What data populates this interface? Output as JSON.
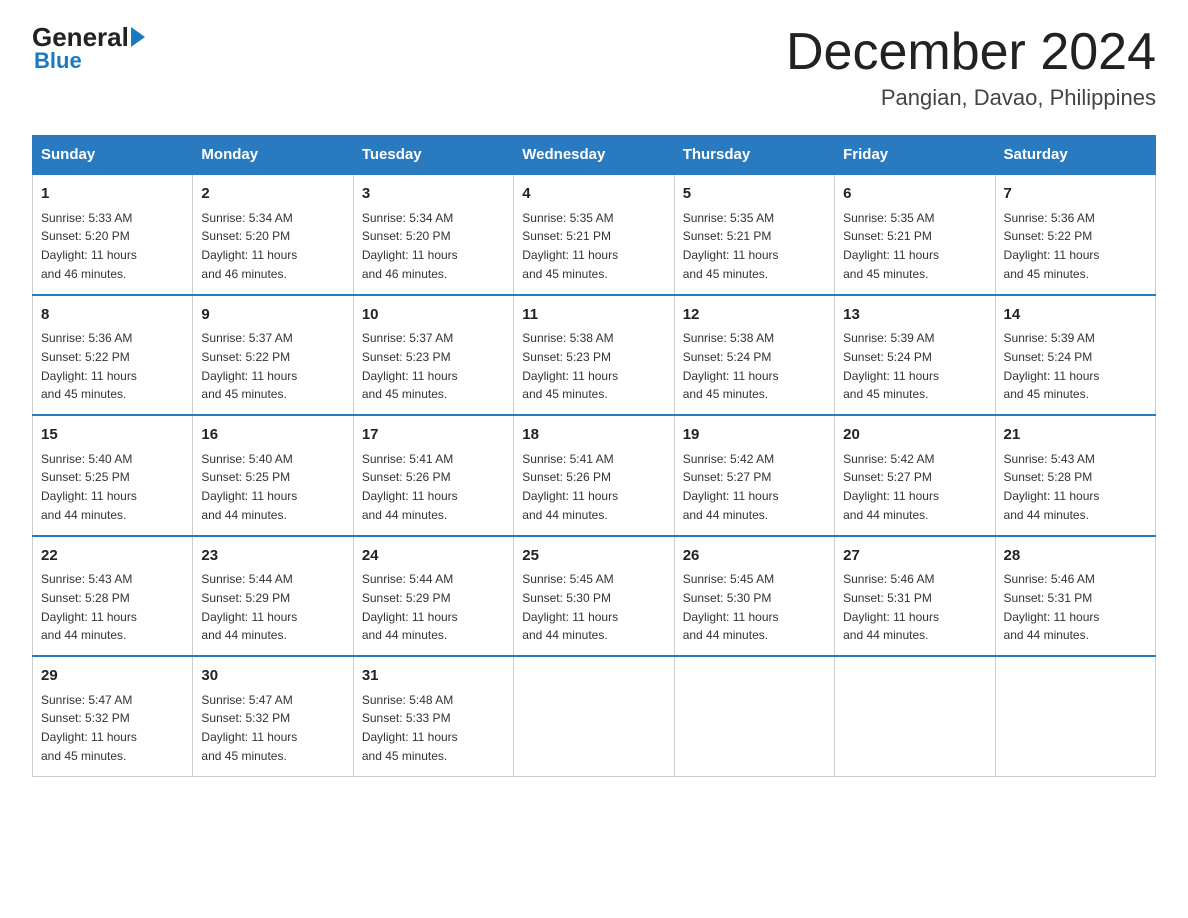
{
  "header": {
    "logo_general": "General",
    "logo_blue": "Blue",
    "month_title": "December 2024",
    "subtitle": "Pangian, Davao, Philippines"
  },
  "days_of_week": [
    "Sunday",
    "Monday",
    "Tuesday",
    "Wednesday",
    "Thursday",
    "Friday",
    "Saturday"
  ],
  "weeks": [
    [
      {
        "day": "1",
        "sunrise": "5:33 AM",
        "sunset": "5:20 PM",
        "daylight": "11 hours and 46 minutes."
      },
      {
        "day": "2",
        "sunrise": "5:34 AM",
        "sunset": "5:20 PM",
        "daylight": "11 hours and 46 minutes."
      },
      {
        "day": "3",
        "sunrise": "5:34 AM",
        "sunset": "5:20 PM",
        "daylight": "11 hours and 46 minutes."
      },
      {
        "day": "4",
        "sunrise": "5:35 AM",
        "sunset": "5:21 PM",
        "daylight": "11 hours and 45 minutes."
      },
      {
        "day": "5",
        "sunrise": "5:35 AM",
        "sunset": "5:21 PM",
        "daylight": "11 hours and 45 minutes."
      },
      {
        "day": "6",
        "sunrise": "5:35 AM",
        "sunset": "5:21 PM",
        "daylight": "11 hours and 45 minutes."
      },
      {
        "day": "7",
        "sunrise": "5:36 AM",
        "sunset": "5:22 PM",
        "daylight": "11 hours and 45 minutes."
      }
    ],
    [
      {
        "day": "8",
        "sunrise": "5:36 AM",
        "sunset": "5:22 PM",
        "daylight": "11 hours and 45 minutes."
      },
      {
        "day": "9",
        "sunrise": "5:37 AM",
        "sunset": "5:22 PM",
        "daylight": "11 hours and 45 minutes."
      },
      {
        "day": "10",
        "sunrise": "5:37 AM",
        "sunset": "5:23 PM",
        "daylight": "11 hours and 45 minutes."
      },
      {
        "day": "11",
        "sunrise": "5:38 AM",
        "sunset": "5:23 PM",
        "daylight": "11 hours and 45 minutes."
      },
      {
        "day": "12",
        "sunrise": "5:38 AM",
        "sunset": "5:24 PM",
        "daylight": "11 hours and 45 minutes."
      },
      {
        "day": "13",
        "sunrise": "5:39 AM",
        "sunset": "5:24 PM",
        "daylight": "11 hours and 45 minutes."
      },
      {
        "day": "14",
        "sunrise": "5:39 AM",
        "sunset": "5:24 PM",
        "daylight": "11 hours and 45 minutes."
      }
    ],
    [
      {
        "day": "15",
        "sunrise": "5:40 AM",
        "sunset": "5:25 PM",
        "daylight": "11 hours and 44 minutes."
      },
      {
        "day": "16",
        "sunrise": "5:40 AM",
        "sunset": "5:25 PM",
        "daylight": "11 hours and 44 minutes."
      },
      {
        "day": "17",
        "sunrise": "5:41 AM",
        "sunset": "5:26 PM",
        "daylight": "11 hours and 44 minutes."
      },
      {
        "day": "18",
        "sunrise": "5:41 AM",
        "sunset": "5:26 PM",
        "daylight": "11 hours and 44 minutes."
      },
      {
        "day": "19",
        "sunrise": "5:42 AM",
        "sunset": "5:27 PM",
        "daylight": "11 hours and 44 minutes."
      },
      {
        "day": "20",
        "sunrise": "5:42 AM",
        "sunset": "5:27 PM",
        "daylight": "11 hours and 44 minutes."
      },
      {
        "day": "21",
        "sunrise": "5:43 AM",
        "sunset": "5:28 PM",
        "daylight": "11 hours and 44 minutes."
      }
    ],
    [
      {
        "day": "22",
        "sunrise": "5:43 AM",
        "sunset": "5:28 PM",
        "daylight": "11 hours and 44 minutes."
      },
      {
        "day": "23",
        "sunrise": "5:44 AM",
        "sunset": "5:29 PM",
        "daylight": "11 hours and 44 minutes."
      },
      {
        "day": "24",
        "sunrise": "5:44 AM",
        "sunset": "5:29 PM",
        "daylight": "11 hours and 44 minutes."
      },
      {
        "day": "25",
        "sunrise": "5:45 AM",
        "sunset": "5:30 PM",
        "daylight": "11 hours and 44 minutes."
      },
      {
        "day": "26",
        "sunrise": "5:45 AM",
        "sunset": "5:30 PM",
        "daylight": "11 hours and 44 minutes."
      },
      {
        "day": "27",
        "sunrise": "5:46 AM",
        "sunset": "5:31 PM",
        "daylight": "11 hours and 44 minutes."
      },
      {
        "day": "28",
        "sunrise": "5:46 AM",
        "sunset": "5:31 PM",
        "daylight": "11 hours and 44 minutes."
      }
    ],
    [
      {
        "day": "29",
        "sunrise": "5:47 AM",
        "sunset": "5:32 PM",
        "daylight": "11 hours and 45 minutes."
      },
      {
        "day": "30",
        "sunrise": "5:47 AM",
        "sunset": "5:32 PM",
        "daylight": "11 hours and 45 minutes."
      },
      {
        "day": "31",
        "sunrise": "5:48 AM",
        "sunset": "5:33 PM",
        "daylight": "11 hours and 45 minutes."
      },
      null,
      null,
      null,
      null
    ]
  ],
  "labels": {
    "sunrise": "Sunrise:",
    "sunset": "Sunset:",
    "daylight": "Daylight:"
  }
}
